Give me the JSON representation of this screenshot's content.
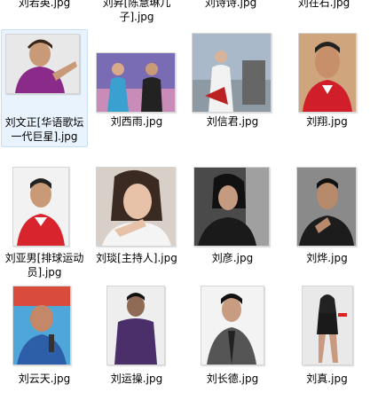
{
  "top_row": [
    {
      "label": "刘若英.jpg"
    },
    {
      "label": "刘昇[陈慧琳儿子].jpg"
    },
    {
      "label": "刘诗诗.jpg"
    },
    {
      "label": "刘在石.jpg"
    }
  ],
  "files": [
    {
      "label": "刘文正[华语歌坛一代巨星].jpg",
      "selected": true,
      "icon": "photo-thumbnail-icon"
    },
    {
      "label": "刘西雨.jpg",
      "icon": "photo-thumbnail-icon"
    },
    {
      "label": "刘信君.jpg",
      "icon": "photo-thumbnail-icon"
    },
    {
      "label": "刘翔.jpg",
      "icon": "photo-thumbnail-icon"
    },
    {
      "label": "刘亚男[排球运动员].jpg",
      "icon": "photo-thumbnail-icon"
    },
    {
      "label": "刘琰[主持人].jpg",
      "icon": "photo-thumbnail-icon"
    },
    {
      "label": "刘彦.jpg",
      "icon": "photo-thumbnail-icon"
    },
    {
      "label": "刘烨.jpg",
      "icon": "photo-thumbnail-icon"
    },
    {
      "label": "刘云天.jpg",
      "icon": "photo-thumbnail-icon"
    },
    {
      "label": "刘运操.jpg",
      "icon": "photo-thumbnail-icon"
    },
    {
      "label": "刘长德.jpg",
      "icon": "photo-thumbnail-icon"
    },
    {
      "label": "刘真.jpg",
      "icon": "photo-thumbnail-icon"
    }
  ],
  "colors": {
    "selection_bg": "#e9f3fd",
    "selection_border": "#c7def5"
  }
}
